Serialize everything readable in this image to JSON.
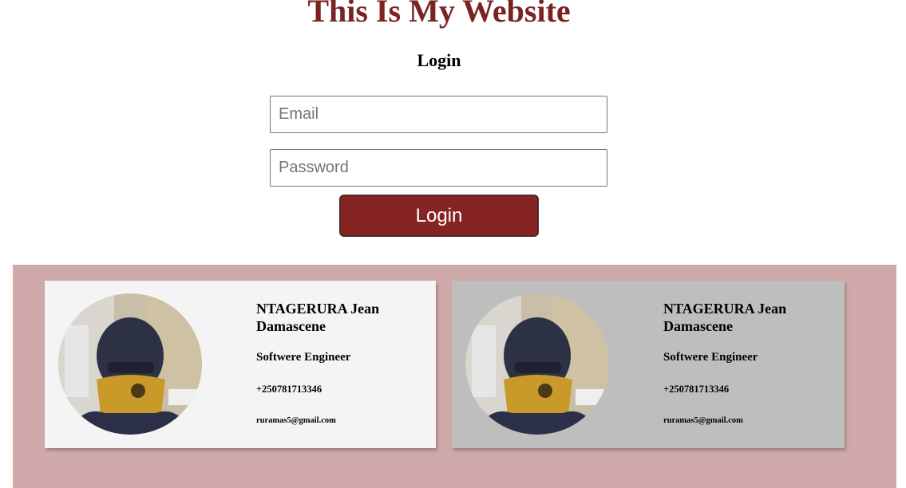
{
  "header": {
    "site_title": "This Is My Website"
  },
  "login_form": {
    "heading": "Login",
    "email_placeholder": "Email",
    "password_placeholder": "Password",
    "submit_label": "Login",
    "accent_color": "#862424"
  },
  "colors": {
    "title": "#7b2222",
    "footer_band": "#d0aaaa",
    "card_1_bg": "#f4f4f4",
    "card_2_bg": "#bebebe"
  },
  "profile_cards": [
    {
      "name": "NTAGERURA Jean Damascene",
      "role": "Softwere Engineer",
      "phone": "+250781713346",
      "email": "ruramas5@gmail.com",
      "photo": "profile-photo"
    },
    {
      "name": "NTAGERURA Jean Damascene",
      "role": "Softwere Engineer",
      "phone": "+250781713346",
      "email": "ruramas5@gmail.com",
      "photo": "profile-photo"
    }
  ]
}
